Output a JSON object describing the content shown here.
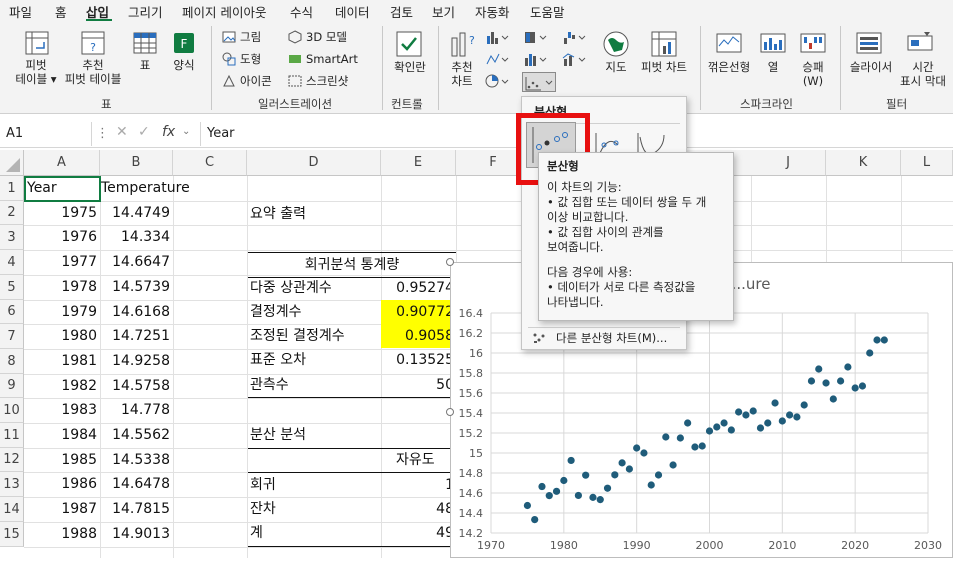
{
  "menu": [
    "파일",
    "홈",
    "삽입",
    "그리기",
    "페이지 레이아웃",
    "수식",
    "데이터",
    "검토",
    "보기",
    "자동화",
    "도움말"
  ],
  "ribbon": {
    "pivot_table": "피벗 테이블",
    "pivot_table_arrow": "피벗\n테이블 ▾",
    "rec_pivot": "추천\n피벗 테이블",
    "table": "표",
    "forms": "양식",
    "pictures": "그림",
    "shapes": "도형",
    "icons": "아이콘",
    "model3d": "3D 모델",
    "smartart": "SmartArt",
    "screenshot": "스크린샷",
    "checkbox": "확인란",
    "rec_charts": "추천\n차트",
    "maps": "지도",
    "pivot_chart": "피벗 차트",
    "line_spark": "꺾은선형",
    "column_spark": "열",
    "winloss_spark": "승패\n(W)",
    "slicer": "슬라이서",
    "timeline": "시간\n표시 막대",
    "groups": {
      "tables": "표",
      "illustrations": "일러스트레이션",
      "controls": "컨트롤",
      "sparklines": "스파크라인",
      "filters": "필터"
    }
  },
  "formula_bar": {
    "name_box": "A1",
    "formula": "Year"
  },
  "columns": [
    "A",
    "B",
    "C",
    "D",
    "E",
    "F",
    "G",
    "H",
    "I",
    "J",
    "K",
    "L"
  ],
  "rows": [
    "1",
    "2",
    "3",
    "4",
    "5",
    "6",
    "7",
    "8",
    "9",
    "10",
    "11",
    "12",
    "13",
    "14",
    "15"
  ],
  "sheet": {
    "A": [
      "Year",
      "1975",
      "1976",
      "1977",
      "1978",
      "1979",
      "1980",
      "1981",
      "1982",
      "1983",
      "1984",
      "1985",
      "1986",
      "1987",
      "1988"
    ],
    "B": [
      "Temperature",
      "14.4749",
      "14.334",
      "14.6647",
      "14.5739",
      "14.6168",
      "14.7251",
      "14.9258",
      "14.5758",
      "14.778",
      "14.5562",
      "14.5338",
      "14.6478",
      "14.7815",
      "14.9013"
    ],
    "D": {
      "summary": "요약 출력",
      "regression_stats": "회귀분석 통계량",
      "multiple_r": "다중 상관계수",
      "r_square": "결정계수",
      "adj_r_square": "조정된 결정계수",
      "std_error": "표준 오차",
      "observations": "관측수",
      "anova": "분산 분석",
      "regression": "회귀",
      "residual": "잔차",
      "total": "계"
    },
    "E": {
      "multiple_r": "0.95274",
      "r_square": "0.90772",
      "adj_r_square": "0.9058",
      "std_error": "0.13525",
      "observations": "50",
      "df_header": "자유도",
      "df_reg": "1",
      "df_res": "48",
      "df_total": "49"
    }
  },
  "dropdown": {
    "title": "분산형",
    "more": "다른 분산형 차트(M)..."
  },
  "tooltip": {
    "title": "분산형",
    "line1": "이 차트의 기능:",
    "line2": "• 값 집합 또는 데이터 쌍을 두 개",
    "line3": "이상 비교합니다.",
    "line4": "• 값 집합 사이의 관계를",
    "line5": "보여줍니다.",
    "line6": "다음 경우에 사용:",
    "line7": "• 데이터가 서로 다른 측정값을",
    "line8": "나타냅니다."
  },
  "chart_data": {
    "type": "scatter",
    "title": "...ure",
    "xlim": [
      1970,
      2030
    ],
    "ylim": [
      14.2,
      16.4
    ],
    "x_ticks": [
      "1970",
      "1980",
      "1990",
      "2000",
      "2010",
      "2020",
      "2030"
    ],
    "y_ticks": [
      "14.2",
      "14.4",
      "14.6",
      "14.8",
      "15",
      "15.2",
      "15.4",
      "15.6",
      "15.8",
      "16",
      "16.2",
      "16.4"
    ],
    "points_x": [
      1975,
      1976,
      1977,
      1978,
      1979,
      1980,
      1981,
      1982,
      1983,
      1984,
      1985,
      1986,
      1987,
      1988,
      1989,
      1990,
      1991,
      1992,
      1993,
      1994,
      1995,
      1996,
      1997,
      1998,
      1999,
      2000,
      2001,
      2002,
      2003,
      2004,
      2005,
      2006,
      2007,
      2008,
      2009,
      2010,
      2011,
      2012,
      2013,
      2014,
      2015,
      2016,
      2017,
      2018,
      2019,
      2020,
      2021,
      2022,
      2023,
      2024
    ],
    "points_y": [
      14.4749,
      14.334,
      14.6647,
      14.5739,
      14.6168,
      14.7251,
      14.9258,
      14.5758,
      14.778,
      14.5562,
      14.5338,
      14.6478,
      14.7815,
      14.9013,
      14.84,
      15.05,
      15.0,
      14.68,
      14.78,
      15.16,
      14.88,
      15.15,
      15.3,
      15.06,
      15.07,
      15.22,
      15.26,
      15.3,
      15.23,
      15.41,
      15.38,
      15.42,
      15.25,
      15.3,
      15.5,
      15.32,
      15.38,
      15.36,
      15.48,
      15.72,
      15.84,
      15.7,
      15.54,
      15.72,
      15.86,
      15.65,
      15.67,
      16.0,
      16.13,
      16.13
    ],
    "color": "#1f5c7a"
  },
  "colors": {
    "highlight_yellow": "#ffff00",
    "red_box": "#e81010",
    "excel_green": "#107c41"
  }
}
